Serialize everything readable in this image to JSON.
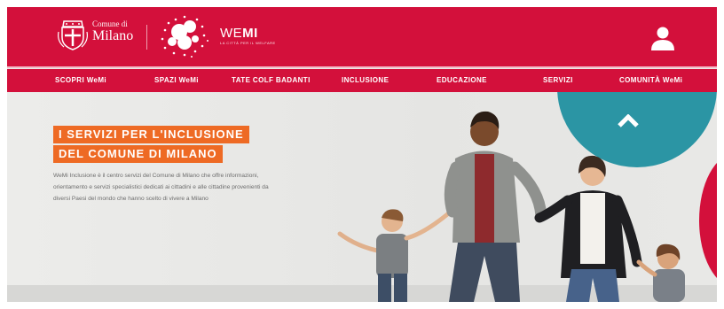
{
  "header": {
    "municipality_line1": "Comune di",
    "municipality_line2": "Milano",
    "brand_name_bold": "WE",
    "brand_name_rest": "MI",
    "brand_tagline": "LA CITTÀ PER IL WELFARE"
  },
  "nav": {
    "items": [
      {
        "label": "SCOPRI WeMi"
      },
      {
        "label": "SPAZI WeMi"
      },
      {
        "label": "TATE COLF BADANTI"
      },
      {
        "label": "INCLUSIONE"
      },
      {
        "label": "EDUCAZIONE"
      },
      {
        "label": "SERVIZI"
      },
      {
        "label": "COMUNITÀ WeMi"
      }
    ]
  },
  "hero": {
    "headline_line1": "I SERVIZI PER L'INCLUSIONE",
    "headline_line2": "DEL COMUNE DI MILANO",
    "description": "WeMi Inclusione è il centro servizi del Comune di Milano che offre informazioni, orientamento e servizi specialistici dedicati ai cittadini e alle cittadine provenienti da diversi Paesi del mondo che hanno scelto di vivere a Milano"
  },
  "colors": {
    "brand_red": "#d3103b",
    "highlight_orange": "#ee6a24",
    "teal": "#2b95a4"
  },
  "icons": {
    "user": "user-icon",
    "scroll_up": "chevron-up-icon",
    "crest": "crest-icon",
    "logo": "wemi-logo-icon"
  }
}
